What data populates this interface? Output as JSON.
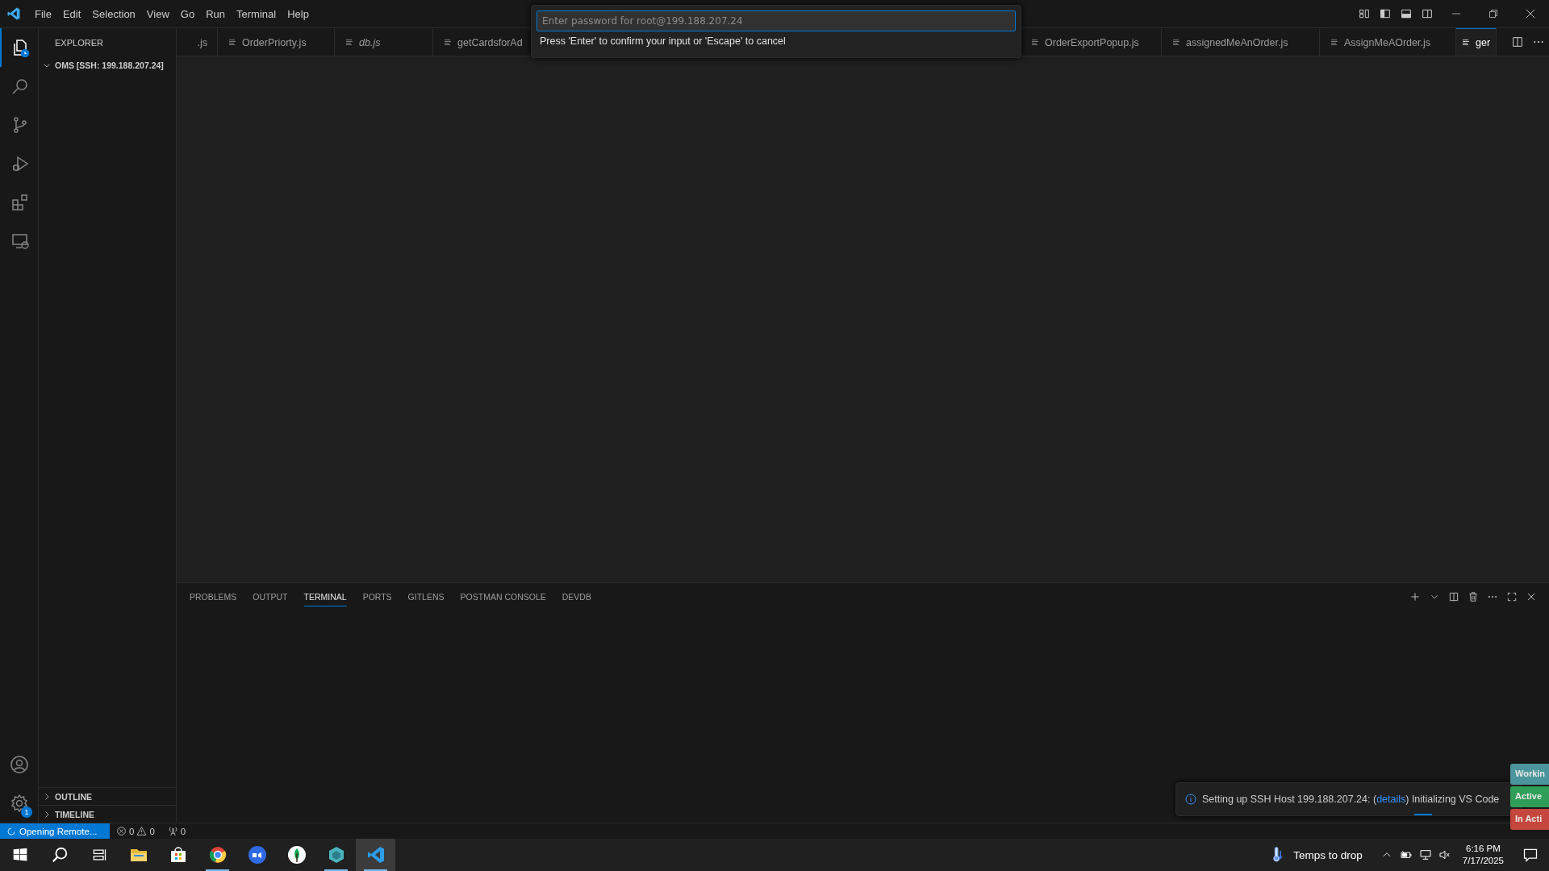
{
  "menu": [
    "File",
    "Edit",
    "Selection",
    "View",
    "Go",
    "Run",
    "Terminal",
    "Help"
  ],
  "quick_input": {
    "placeholder": "Enter password for root@199.188.207.24",
    "hint": "Press 'Enter' to confirm your input or 'Escape' to cancel"
  },
  "activity_bar": [
    {
      "kind": "files",
      "selected": true
    },
    {
      "kind": "search",
      "selected": false
    },
    {
      "kind": "source-control",
      "selected": false
    },
    {
      "kind": "run",
      "selected": false
    },
    {
      "kind": "extensions",
      "selected": false
    },
    {
      "kind": "remote",
      "selected": false
    }
  ],
  "activity_bottom": [
    {
      "kind": "account"
    },
    {
      "kind": "settings",
      "badge": "1"
    }
  ],
  "sidebar": {
    "title": "EXPLORER",
    "folder": {
      "label": "OMS [SSH: 199.188.207.24]",
      "expanded": true
    },
    "sections": [
      {
        "label": "OUTLINE",
        "expanded": false
      },
      {
        "label": "TIMELINE",
        "expanded": false
      }
    ]
  },
  "tabs": [
    {
      "label": ".js",
      "preview": false,
      "selected": false
    },
    {
      "label": "OrderPriorty.js",
      "preview": false,
      "selected": false
    },
    {
      "label": "db.js",
      "preview": true,
      "selected": false
    },
    {
      "label": "getCardsforAd",
      "preview": false,
      "selected": false
    },
    {
      "label": "OrderExportPopup.js",
      "preview": false,
      "selected": false
    },
    {
      "label": "assignedMeAnOrder.js",
      "preview": false,
      "selected": false
    },
    {
      "label": "AssignMeAOrder.js",
      "preview": false,
      "selected": false
    },
    {
      "label": "ger",
      "preview": false,
      "selected": true
    }
  ],
  "panel": {
    "tabs": [
      {
        "label": "PROBLEMS",
        "selected": false
      },
      {
        "label": "OUTPUT",
        "selected": false
      },
      {
        "label": "TERMINAL",
        "selected": true
      },
      {
        "label": "PORTS",
        "selected": false
      },
      {
        "label": "GITLENS",
        "selected": false
      },
      {
        "label": "POSTMAN CONSOLE",
        "selected": false
      },
      {
        "label": "DEVDB",
        "selected": false
      }
    ]
  },
  "notification": {
    "text_before": "Setting up SSH Host 199.188.207.24: (",
    "link": "details",
    "text_after": ") Initializing VS Code"
  },
  "side_tags": [
    {
      "label": "Workin",
      "color": "#4b969c"
    },
    {
      "label": "Active",
      "color": "#2f9e58"
    },
    {
      "label": "In Acti",
      "color": "#c4463c"
    }
  ],
  "status_bar": {
    "remote": "Opening Remote...",
    "errors": "0",
    "warnings": "0",
    "ports": "0"
  },
  "taskbar": {
    "apps": [
      {
        "kind": "folder",
        "running": false,
        "selected": false
      },
      {
        "kind": "store",
        "running": false,
        "selected": false
      },
      {
        "kind": "browser",
        "running": true,
        "selected": false
      },
      {
        "kind": "video",
        "running": false,
        "selected": false
      },
      {
        "kind": "leaf",
        "running": false,
        "selected": false
      },
      {
        "kind": "hexagon",
        "running": true,
        "selected": false
      },
      {
        "kind": "code",
        "running": true,
        "selected": true
      }
    ],
    "weather": "Temps to drop",
    "time": "6:16 PM",
    "date": "7/17/2025"
  }
}
